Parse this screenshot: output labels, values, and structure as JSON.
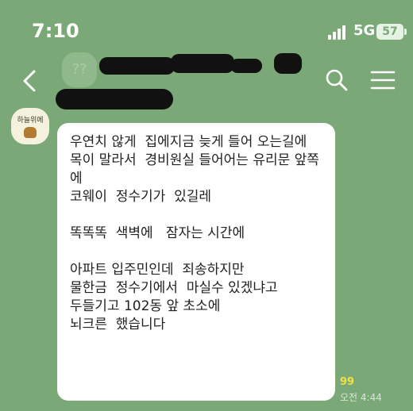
{
  "statusbar": {
    "time": "7:10",
    "network": "5G",
    "battery": "57"
  },
  "header": {
    "back_icon": "chevron-left-icon",
    "search_icon": "search-icon",
    "menu_icon": "hamburger-menu-icon",
    "faint_avatar_text": "??"
  },
  "message": {
    "sender_label": "하늘위에",
    "text": "우연치 않게  집에지금 늦게 들어 오는길에\n목이 말라서  경비원실 들어어는 유리문 앞쪽에\n코웨이  정수기가  있길레\n\n똑똑똑  색벽에   잠자는 시간에\n\n아파트 입주민인데  죄송하지만\n물한금  정수기에서  마실수 있겠냐고\n두들기고 102동 앞 초소에\n뇌크른  했습니다",
    "unread_count": "99",
    "timestamp": "오전 4:44"
  },
  "colors": {
    "background": "#7aa977",
    "bubble": "#ffffff",
    "unread": "#f2e04a"
  }
}
